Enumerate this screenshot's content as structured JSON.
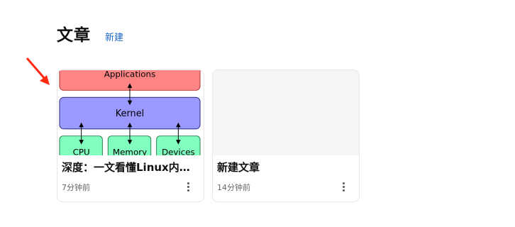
{
  "header": {
    "title": "文章",
    "new_link": "新建"
  },
  "cards": [
    {
      "title": "深度：一文看懂Linux内核！Linux内核架构和工作原理详解",
      "time": "7分钟前",
      "thumbnail": {
        "top_label": "Applications",
        "middle_label": "Kernel",
        "bottom_labels": [
          "CPU",
          "Memory",
          "Devices"
        ]
      }
    },
    {
      "title": "新建文章",
      "time": "14分钟前"
    }
  ],
  "colors": {
    "link": "#1a67c7",
    "arrow": "#ff2a12",
    "applications_fill": "#ff8585",
    "kernel_fill": "#9999ff",
    "device_fill": "#80ffbf"
  }
}
